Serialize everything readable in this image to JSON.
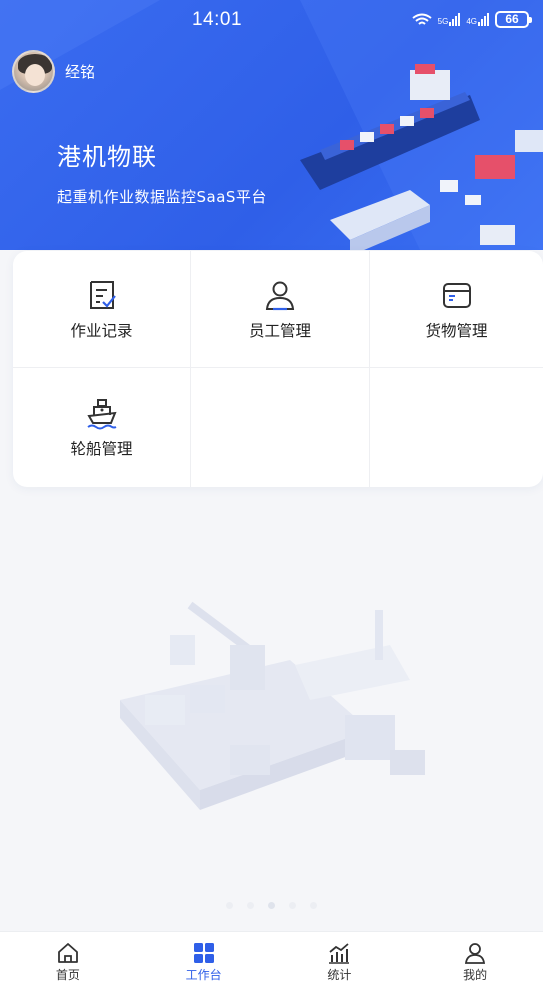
{
  "status_bar": {
    "time": "14:01",
    "battery": "66",
    "network_1": "5G",
    "network_2": "4G"
  },
  "user": {
    "name": "经铭"
  },
  "header": {
    "title": "港机物联",
    "subtitle": "起重机作业数据监控SaaS平台"
  },
  "grid": {
    "items": [
      {
        "label": "作业记录",
        "icon": "document-check-icon"
      },
      {
        "label": "员工管理",
        "icon": "person-icon"
      },
      {
        "label": "货物管理",
        "icon": "cargo-box-icon"
      },
      {
        "label": "轮船管理",
        "icon": "ship-icon"
      }
    ]
  },
  "tabbar": {
    "items": [
      {
        "label": "首页",
        "icon": "home-icon"
      },
      {
        "label": "工作台",
        "icon": "grid-icon"
      },
      {
        "label": "统计",
        "icon": "chart-icon"
      },
      {
        "label": "我的",
        "icon": "user-icon"
      }
    ],
    "active_index": 1
  },
  "colors": {
    "primary": "#2F5FE8",
    "tab_inactive": "#333333",
    "background": "#F5F6F9"
  }
}
